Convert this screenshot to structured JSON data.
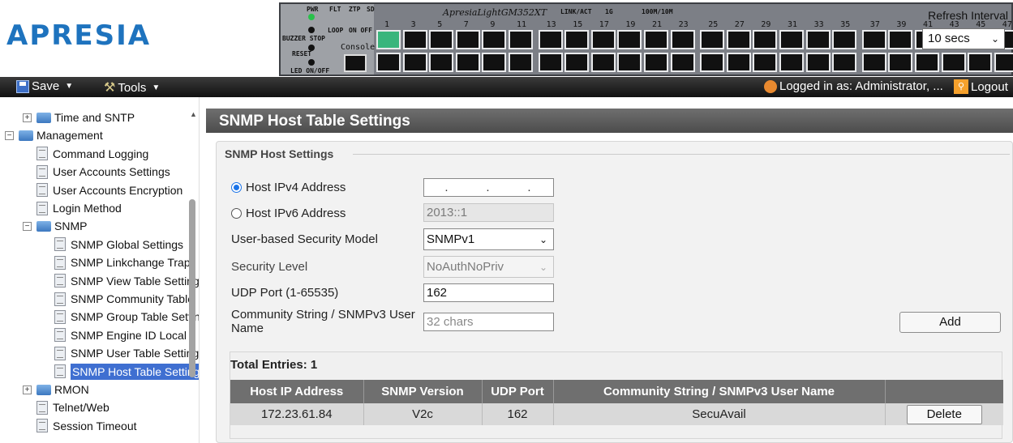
{
  "header": {
    "logo": "APRESIA",
    "device": {
      "model": "ApresiaLightGM352XT",
      "led_labels": [
        "PWR",
        "FLT",
        "ZTP",
        "SD"
      ],
      "buttons": [
        "BUZZER STOP",
        "RESET",
        "LED ON/OFF"
      ],
      "loop_label": "LOOP",
      "on_off_label": "ON OFF",
      "console_label": "Console",
      "link_act_label": "LINK/ACT",
      "speed_1g": "1G",
      "speed_100m": "100M/10M",
      "port_numbers_top": [
        "1",
        "3",
        "5",
        "7",
        "9",
        "11",
        "13",
        "15",
        "17",
        "19",
        "21",
        "23",
        "25",
        "27",
        "29",
        "31",
        "33",
        "35",
        "37",
        "39",
        "41",
        "43",
        "45",
        "47"
      ]
    },
    "refresh": {
      "label": "Refresh Interval",
      "value": "10 secs"
    }
  },
  "toolbar": {
    "save": "Save",
    "tools": "Tools",
    "user": "Logged in as: Administrator, ...",
    "logout": "Logout"
  },
  "sidebar": {
    "items": [
      {
        "label": "Time and SNTP",
        "type": "folder",
        "level": 1,
        "expander": "+"
      },
      {
        "label": "Management",
        "type": "folder",
        "level": 0,
        "expander": "-"
      },
      {
        "label": "Command Logging",
        "type": "doc",
        "level": 1
      },
      {
        "label": "User Accounts Settings",
        "type": "doc",
        "level": 1
      },
      {
        "label": "User Accounts Encryption",
        "type": "doc",
        "level": 1
      },
      {
        "label": "Login Method",
        "type": "doc",
        "level": 1
      },
      {
        "label": "SNMP",
        "type": "folder",
        "level": 1,
        "expander": "-"
      },
      {
        "label": "SNMP Global Settings",
        "type": "doc",
        "level": 2
      },
      {
        "label": "SNMP Linkchange Trap",
        "type": "doc",
        "level": 2
      },
      {
        "label": "SNMP View Table Settings",
        "type": "doc",
        "level": 2
      },
      {
        "label": "SNMP Community Table",
        "type": "doc",
        "level": 2
      },
      {
        "label": "SNMP Group Table Settings",
        "type": "doc",
        "level": 2
      },
      {
        "label": "SNMP Engine ID Local",
        "type": "doc",
        "level": 2
      },
      {
        "label": "SNMP User Table Settings",
        "type": "doc",
        "level": 2
      },
      {
        "label": "SNMP Host Table Settings",
        "type": "doc",
        "level": 2,
        "selected": true
      },
      {
        "label": "RMON",
        "type": "folder",
        "level": 1,
        "expander": "+"
      },
      {
        "label": "Telnet/Web",
        "type": "doc",
        "level": 1
      },
      {
        "label": "Session Timeout",
        "type": "doc",
        "level": 1
      }
    ]
  },
  "main": {
    "title": "SNMP Host Table Settings",
    "legend": "SNMP Host Settings",
    "form": {
      "ipv4_label": "Host IPv4 Address",
      "ipv6_label": "Host IPv6 Address",
      "ipv6_value": "2013::1",
      "usm_label": "User-based Security Model",
      "usm_value": "SNMPv1",
      "sec_level_label": "Security Level",
      "sec_level_value": "NoAuthNoPriv",
      "udp_label": "UDP Port (1-65535)",
      "udp_value": "162",
      "community_label": "Community String / SNMPv3 User Name",
      "community_placeholder": "32 chars",
      "add_label": "Add"
    },
    "entries": {
      "title": "Total Entries: 1",
      "columns": [
        "Host IP Address",
        "SNMP Version",
        "UDP Port",
        "Community String / SNMPv3 User Name",
        ""
      ],
      "rows": [
        {
          "host": "172.23.61.84",
          "version": "V2c",
          "port": "162",
          "community": "SecuAvail",
          "action": "Delete"
        }
      ]
    }
  },
  "colors": {
    "logo_blue": "#1e73be",
    "selected_blue": "#3f6fd1",
    "title_bar": "#5e5e5e",
    "table_header": "#6f6f6f",
    "radio_blue": "#1a73e8"
  }
}
